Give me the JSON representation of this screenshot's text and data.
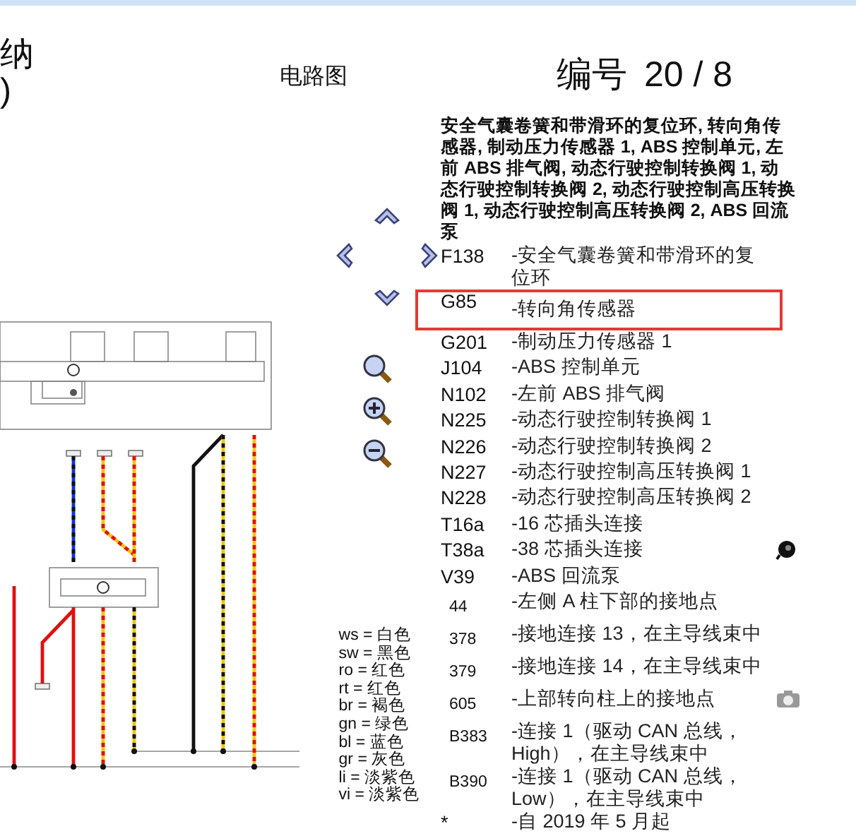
{
  "header": {
    "cut_title_lines": [
      "纳",
      ")"
    ],
    "center_title": "电路图",
    "number_label": "编号",
    "number_value": "20 / 8"
  },
  "nav": {
    "buttons": [
      {
        "kind": "up"
      },
      {
        "kind": "left"
      },
      {
        "kind": "right"
      },
      {
        "kind": "down"
      },
      {
        "kind": "zoom"
      },
      {
        "kind": "zoom-in"
      },
      {
        "kind": "zoom-out"
      }
    ]
  },
  "color_legend": [
    "ws = 白色",
    "sw = 黑色",
    "ro = 红色",
    "rt = 红色",
    "br = 褐色",
    "gn = 绿色",
    "bl = 蓝色",
    "gr = 灰色",
    "li = 淡紫色",
    "vi = 淡紫色"
  ],
  "components": {
    "heading": "安全气囊卷簧和带滑环的复位环, 转向角传感器, 制动压力传感器 1, ABS 控制单元, 左前 ABS 排气阀, 动态行驶控制转换阀 1, 动态行驶控制转换阀 2, 动态行驶控制高压转换阀 1, 动态行驶控制高压转换阀 2, ABS 回流泵",
    "items": [
      {
        "code": "F138",
        "text": "-安全气囊卷簧和带滑环的复位环",
        "kind": "part",
        "selected": false
      },
      {
        "code": "G85",
        "text": "-转向角传感器",
        "kind": "part",
        "selected": true
      },
      {
        "code": "G201",
        "text": "-制动压力传感器 1",
        "kind": "part",
        "selected": false
      },
      {
        "code": "J104",
        "text": "-ABS 控制单元",
        "kind": "part",
        "selected": false
      },
      {
        "code": "N102",
        "text": "-左前 ABS 排气阀",
        "kind": "part",
        "selected": false
      },
      {
        "code": "N225",
        "text": "-动态行驶控制转换阀 1",
        "kind": "part",
        "selected": false
      },
      {
        "code": "N226",
        "text": "-动态行驶控制转换阀 2",
        "kind": "part",
        "selected": false
      },
      {
        "code": "N227",
        "text": "-动态行驶控制高压转换阀 1",
        "kind": "part",
        "selected": false
      },
      {
        "code": "N228",
        "text": "-动态行驶控制高压转换阀 2",
        "kind": "part",
        "selected": false
      },
      {
        "code": "T16a",
        "text": "-16 芯插头连接",
        "kind": "part",
        "selected": false
      },
      {
        "code": "T38a",
        "text": "-38 芯插头连接",
        "kind": "plug",
        "selected": false
      },
      {
        "code": "V39",
        "text": "-ABS 回流泵",
        "kind": "part",
        "selected": false
      },
      {
        "code": "44",
        "text": "-左侧 A 柱下部的接地点",
        "kind": "point",
        "selected": false
      },
      {
        "code": "378",
        "text": "-接地连接 13，在主导线束中",
        "kind": "point",
        "selected": false
      },
      {
        "code": "379",
        "text": "-接地连接 14，在主导线束中",
        "kind": "point",
        "selected": false
      },
      {
        "code": "605",
        "text": "-上部转向柱上的接地点",
        "kind": "photo",
        "selected": false
      },
      {
        "code": "B383",
        "text": "-连接 1（驱动 CAN 总线，High），在主导线束中",
        "kind": "point",
        "selected": false
      },
      {
        "code": "B390",
        "text": "-连接 1（驱动 CAN 总线，Low），在主导线束中",
        "kind": "point",
        "selected": false
      },
      {
        "code": "*",
        "text": "-自 2019 年 5 月起",
        "kind": "part",
        "selected": false
      }
    ]
  }
}
